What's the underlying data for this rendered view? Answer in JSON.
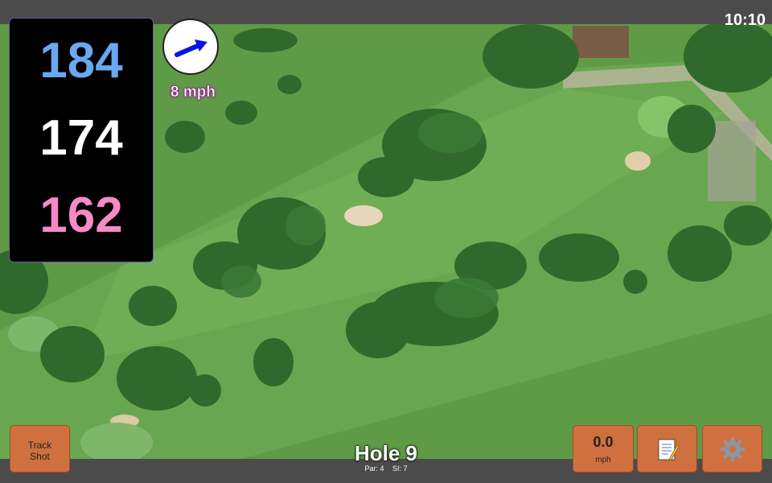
{
  "status": {
    "time": "10:10"
  },
  "distances": {
    "back": "184",
    "middle": "174",
    "front": "162"
  },
  "wind": {
    "label": "8 mph",
    "icon": "wind-direction-arrow-icon"
  },
  "buttons": {
    "track_shot": [
      "Track",
      "Shot"
    ],
    "speed_value": "0.0",
    "speed_unit": "mph",
    "notes_icon": "notepad-icon",
    "settings_icon": "gear-icon"
  },
  "hole": {
    "title": "Hole 9",
    "par": "Par: 4",
    "stroke_index": "SI: 7"
  },
  "colors": {
    "back": "#6aa8ef",
    "middle": "#ffffff",
    "front": "#f58ac6",
    "button": "#d0703f"
  }
}
